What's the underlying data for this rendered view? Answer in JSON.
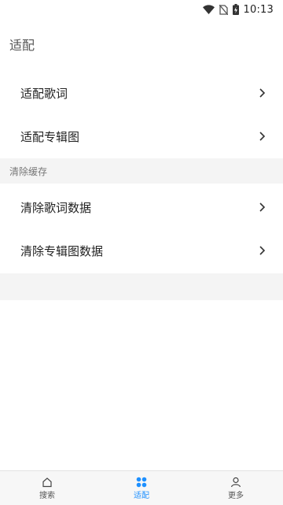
{
  "status_bar": {
    "time": "10:13",
    "icons": [
      "wifi-icon",
      "no-sim-icon",
      "battery-charging-icon"
    ]
  },
  "page": {
    "section1_title": "适配",
    "section2_title": "清除缓存"
  },
  "menu": {
    "lyrics_adapt": "适配歌词",
    "album_adapt": "适配专辑图",
    "clear_lyrics": "清除歌词数据",
    "clear_album": "清除专辑图数据"
  },
  "bottom_nav": {
    "items": [
      {
        "label": "搜索",
        "icon": "home-icon",
        "active": false
      },
      {
        "label": "适配",
        "icon": "grid-icon",
        "active": true
      },
      {
        "label": "更多",
        "icon": "person-icon",
        "active": false
      }
    ]
  },
  "colors": {
    "accent": "#1e90ff",
    "section_bg": "#f4f4f4"
  }
}
